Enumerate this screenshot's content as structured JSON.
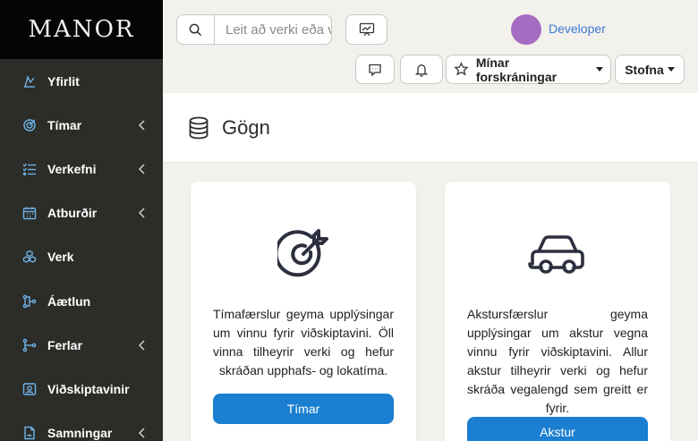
{
  "brand": {
    "name": "MANOR"
  },
  "sidebar": {
    "items": [
      {
        "label": "Yfirlit",
        "icon": "dashboard-icon",
        "has_children": false
      },
      {
        "label": "Tímar",
        "icon": "target-icon",
        "has_children": true
      },
      {
        "label": "Verkefni",
        "icon": "tasks-icon",
        "has_children": true
      },
      {
        "label": "Atburðir",
        "icon": "calendar-icon",
        "has_children": true
      },
      {
        "label": "Verk",
        "icon": "cubes-icon",
        "has_children": false
      },
      {
        "label": "Áætlun",
        "icon": "plan-icon",
        "has_children": false
      },
      {
        "label": "Ferlar",
        "icon": "process-icon",
        "has_children": true
      },
      {
        "label": "Viðskiptavinir",
        "icon": "customers-icon",
        "has_children": false
      },
      {
        "label": "Samningar",
        "icon": "contracts-icon",
        "has_children": true
      }
    ]
  },
  "topbar": {
    "search": {
      "placeholder": "Leit að verki eða viðskiptavini"
    },
    "user": {
      "name": "Developer"
    },
    "favorites_label": "Mínar forskráningar",
    "create_label": "Stofna"
  },
  "page": {
    "title": "Gögn",
    "icon": "database-icon"
  },
  "cards": [
    {
      "icon": "target-icon",
      "description": "Tímafærslur geyma upplýsingar um vinnu fyrir viðskiptavini. Öll vinna tilheyrir verki og hefur skráðan upphafs- og lokatíma.",
      "button": "Tímar"
    },
    {
      "icon": "car-icon",
      "description": "Akstursfærslur geyma upplýsingar um akstur vegna vinnu fyrir viðskiptavini. Allur akstur tilheyrir verki og hefur skráða vegalengd sem greitt er fyrir.",
      "button": "Akstur"
    }
  ],
  "colors": {
    "sidebar_bg": "#2c2c28",
    "brand_bg": "#050505",
    "page_bg": "#f3f1ec",
    "accent": "#1a7fd0",
    "icon_blue": "#6fb3e8",
    "avatar": "#a56cc1",
    "link": "#3a7bd5"
  }
}
